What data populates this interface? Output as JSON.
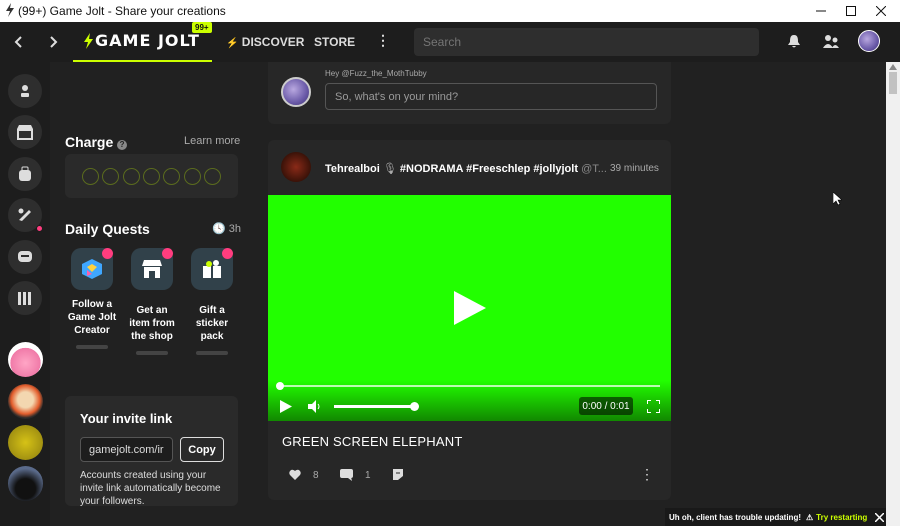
{
  "window": {
    "title": "(99+) Game Jolt - Share your creations"
  },
  "topbar": {
    "logo_text": "GAME JOLT",
    "badge": "99+",
    "discover": "DISCOVER",
    "store": "STORE",
    "search_placeholder": "Search"
  },
  "charge": {
    "title": "Charge",
    "learn_more": "Learn more",
    "orbs": 7
  },
  "daily_quests": {
    "title": "Daily Quests",
    "time": "3h",
    "quests": [
      {
        "label": "Follow a Game Jolt Creator"
      },
      {
        "label": "Get an item from the shop"
      },
      {
        "label": "Gift a sticker pack"
      }
    ]
  },
  "invite": {
    "title": "Your invite link",
    "value": "gamejolt.com/ir",
    "copy": "Copy",
    "desc": "Accounts created using your invite link automatically become your followers."
  },
  "composer": {
    "hey": "Hey @Fuzz_the_MothTubby",
    "placeholder": "So, what's on your mind?"
  },
  "post": {
    "author": "Tehrealboi",
    "tags": "#NODRAMA #Freeschlep #jollyjolt",
    "handle": "@T...",
    "time": "39 minutes",
    "video_time": "0:00 / 0:01",
    "title": "GREEN SCREEN ELEPHANT",
    "likes": "8",
    "comments": "1"
  },
  "toast": {
    "text": "Uh oh, client has trouble updating!",
    "action": "Try restarting"
  },
  "colors": {
    "accent": "#ccff00",
    "notify": "#ff3d7f",
    "video": "#22ff00"
  }
}
